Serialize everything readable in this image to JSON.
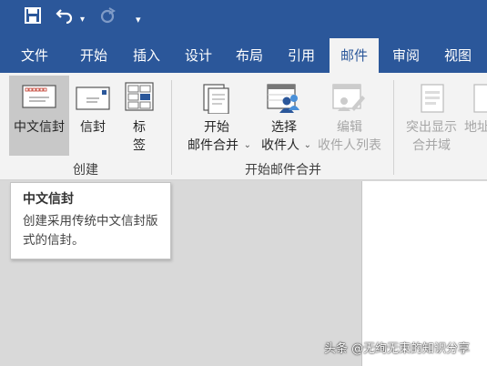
{
  "quick_access": {
    "save_icon": "save-icon",
    "undo_icon": "undo-icon",
    "redo_icon": "redo-icon",
    "customize_icon": "customize-icon"
  },
  "tabs": [
    {
      "label": "文件"
    },
    {
      "label": "开始"
    },
    {
      "label": "插入"
    },
    {
      "label": "设计"
    },
    {
      "label": "布局"
    },
    {
      "label": "引用"
    },
    {
      "label": "邮件",
      "active": true
    },
    {
      "label": "审阅"
    },
    {
      "label": "视图"
    }
  ],
  "ribbon": {
    "create_group": {
      "label": "创建",
      "chinese_envelope": {
        "label": "中文信封",
        "icon": "chinese-envelope-icon"
      },
      "envelopes": {
        "label": "信封",
        "icon": "envelope-icon"
      },
      "labels": {
        "label_line1": "标",
        "label_line2": "签",
        "icon": "labels-icon"
      }
    },
    "mail_merge_group": {
      "label": "开始邮件合并",
      "start": {
        "label_line1": "开始",
        "label_line2": "邮件合并",
        "icon": "start-mail-merge-icon"
      },
      "select": {
        "label_line1": "选择",
        "label_line2": "收件人",
        "icon": "select-recipients-icon"
      },
      "edit": {
        "label_line1": "编辑",
        "label_line2": "收件人列表",
        "icon": "edit-recipient-list-icon"
      }
    },
    "write_group": {
      "highlight": {
        "label_line1": "突出显示",
        "label_line2": "合并域",
        "icon": "highlight-merge-fields-icon"
      },
      "address": {
        "label_line1": "地址",
        "icon": "address-block-icon"
      }
    }
  },
  "tooltip": {
    "title": "中文信封",
    "body": "创建采用传统中文信封版式的信封。"
  },
  "watermark": "头条 @无绚无束的知识分享"
}
